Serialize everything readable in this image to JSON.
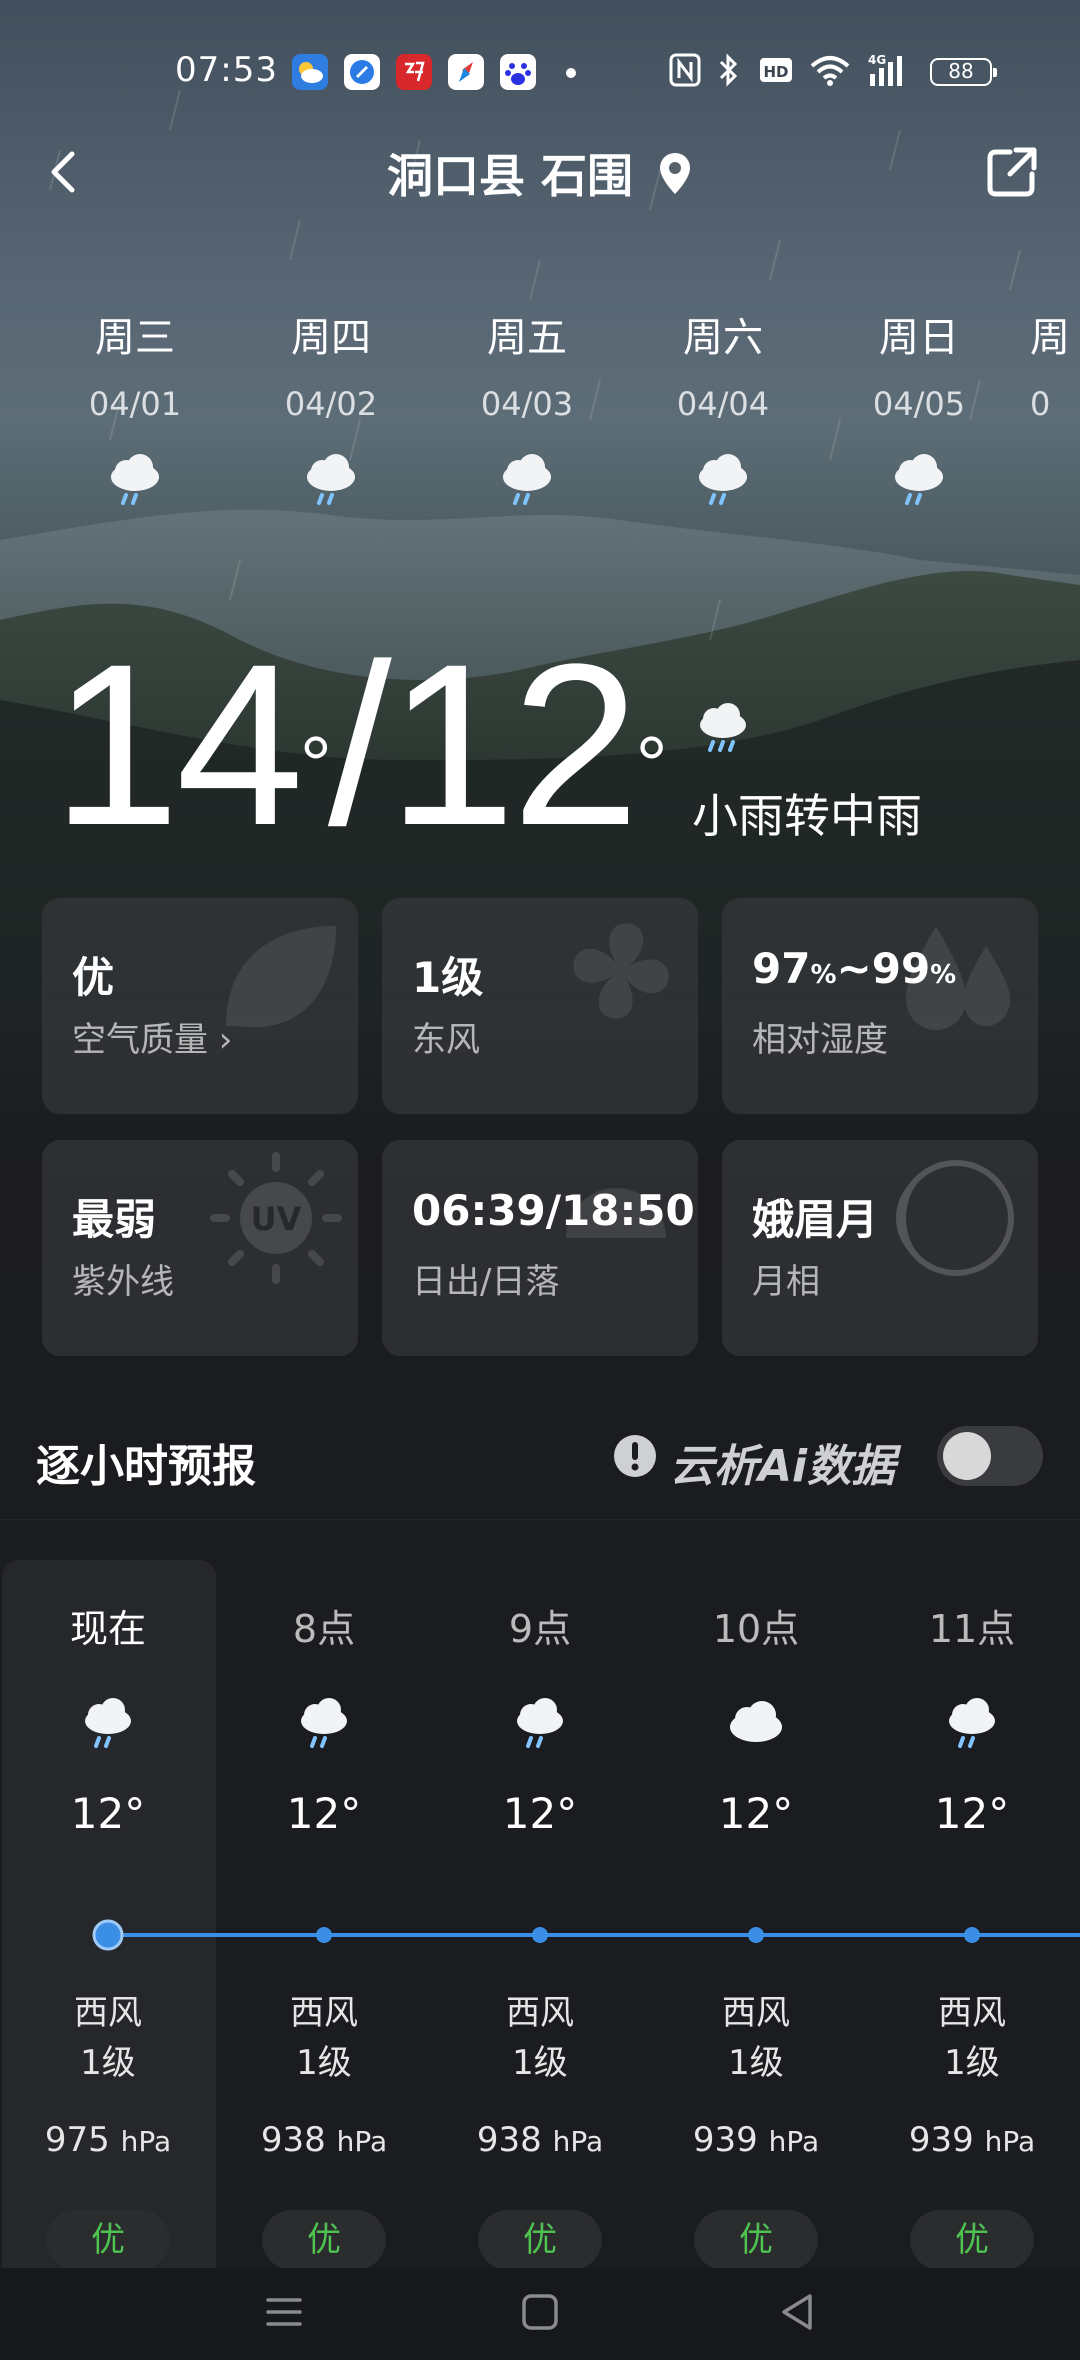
{
  "status_bar": {
    "time": "07:53",
    "battery": "88",
    "network": "4G",
    "hd": "HD"
  },
  "header": {
    "location": "洞口县 石围"
  },
  "days": [
    {
      "name": "周三",
      "date": "04/01",
      "icon": "rain-cloud-icon"
    },
    {
      "name": "周四",
      "date": "04/02",
      "icon": "rain-cloud-icon"
    },
    {
      "name": "周五",
      "date": "04/03",
      "icon": "rain-cloud-icon"
    },
    {
      "name": "周六",
      "date": "04/04",
      "icon": "rain-cloud-icon"
    },
    {
      "name": "周日",
      "date": "04/05",
      "icon": "rain-cloud-icon"
    },
    {
      "name": "周",
      "date": "0",
      "icon": "rain-cloud-icon"
    }
  ],
  "current": {
    "high": "14",
    "low": "12",
    "separator": "/",
    "degree": "°",
    "condition": "小雨转中雨"
  },
  "cards": {
    "air_quality": {
      "value": "优",
      "label": "空气质量 ›"
    },
    "wind": {
      "value": "1级",
      "label": "东风"
    },
    "humidity": {
      "value_from": "97",
      "value_to": "99",
      "unit": "%",
      "sep": "~",
      "label": "相对湿度"
    },
    "uv": {
      "value": "最弱",
      "label": "紫外线"
    },
    "sun": {
      "value": "06:39/18:50",
      "label": "日出/日落"
    },
    "moon": {
      "value": "娥眉月",
      "label": "月相"
    }
  },
  "hourly": {
    "title": "逐小时预报",
    "ai_label": "云析Ai数据",
    "toggle_on": false,
    "hours": [
      {
        "label": "现在",
        "icon": "rain-cloud-icon",
        "temp": "12°",
        "wind_dir": "西风",
        "wind_level": "1级",
        "pressure": "975",
        "pressure_unit": "hPa",
        "aq": "优"
      },
      {
        "label": "8点",
        "icon": "rain-cloud-icon",
        "temp": "12°",
        "wind_dir": "西风",
        "wind_level": "1级",
        "pressure": "938",
        "pressure_unit": "hPa",
        "aq": "优"
      },
      {
        "label": "9点",
        "icon": "rain-cloud-icon",
        "temp": "12°",
        "wind_dir": "西风",
        "wind_level": "1级",
        "pressure": "938",
        "pressure_unit": "hPa",
        "aq": "优"
      },
      {
        "label": "10点",
        "icon": "cloud-icon",
        "temp": "12°",
        "wind_dir": "西风",
        "wind_level": "1级",
        "pressure": "939",
        "pressure_unit": "hPa",
        "aq": "优"
      },
      {
        "label": "11点",
        "icon": "rain-cloud-icon",
        "temp": "12°",
        "wind_dir": "西风",
        "wind_level": "1级",
        "pressure": "939",
        "pressure_unit": "hPa",
        "aq": "优"
      }
    ]
  },
  "colors": {
    "accent_blue": "#3b8ee6",
    "aq_green": "#4fc24f"
  }
}
